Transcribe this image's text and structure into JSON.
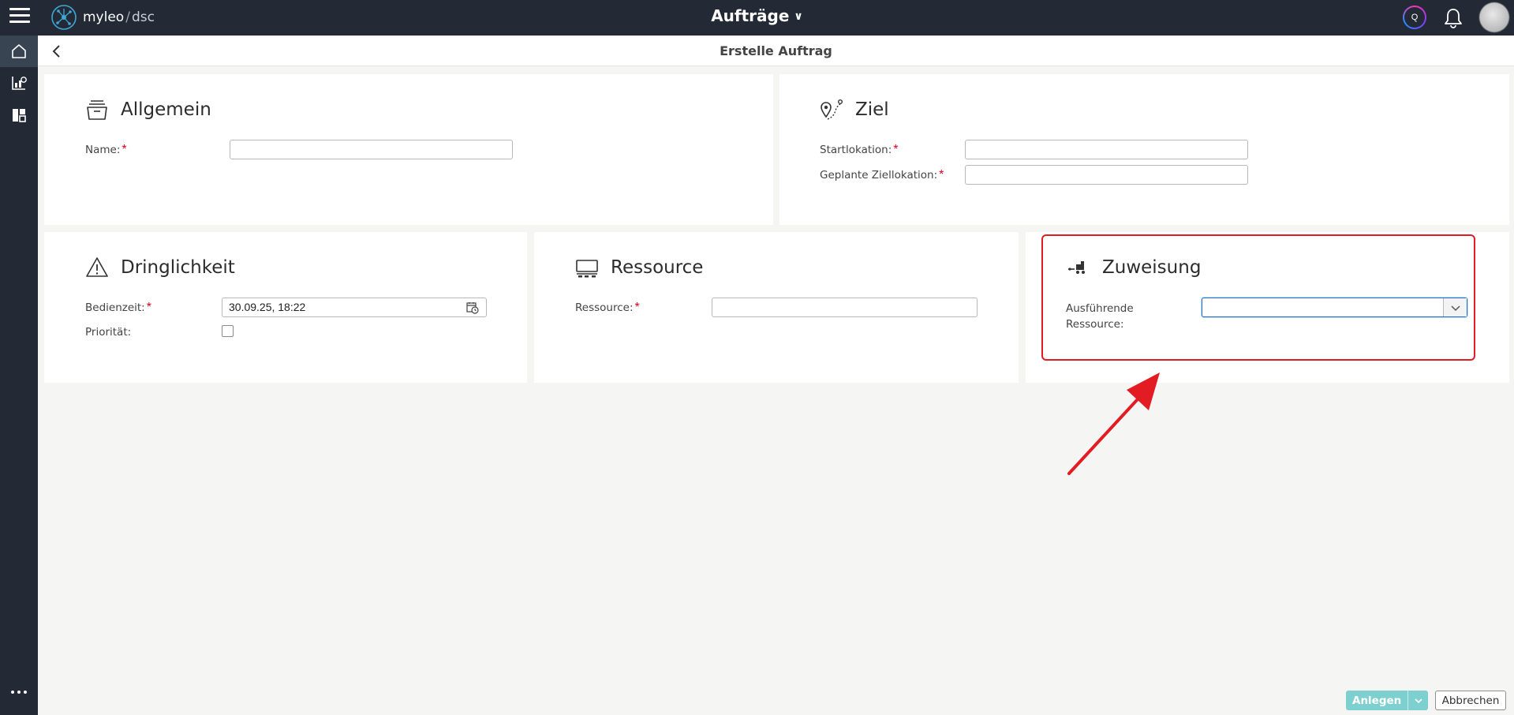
{
  "topbar": {
    "brand_name": "myleo",
    "brand_sep": "/",
    "brand_suffix": "dsc",
    "app_title": "Aufträge",
    "q_badge": "Q",
    "icons": [
      "menu-icon",
      "logo-icon",
      "chevron-down-icon",
      "q-icon",
      "bell-icon",
      "avatar"
    ]
  },
  "sidebar": {
    "items": [
      {
        "icon": "home-icon"
      },
      {
        "icon": "chart-icon"
      },
      {
        "icon": "dashboard-icon"
      }
    ],
    "more_icon": "more-icon"
  },
  "page": {
    "title": "Erstelle Auftrag",
    "back_icon": "back-arrow-icon"
  },
  "allgemein": {
    "title": "Allgemein",
    "name_label": "Name:",
    "name_value": ""
  },
  "ziel": {
    "title": "Ziel",
    "start_label": "Startlokation:",
    "start_value": "",
    "ziel_label": "Geplante Ziellokation:",
    "ziel_value": ""
  },
  "dringlichkeit": {
    "title": "Dringlichkeit",
    "bedienzeit_label": "Bedienzeit:",
    "bedienzeit_value": "30.09.25, 18:22",
    "prioritaet_label": "Priorität:",
    "prioritaet_checked": false
  },
  "ressource": {
    "title": "Ressource",
    "ressource_label": "Ressource:",
    "ressource_value": ""
  },
  "zuweisung": {
    "title": "Zuweisung",
    "label_line1": "Ausführende",
    "label_line2": "Ressource:",
    "selected_value": ""
  },
  "actions": {
    "create_label": "Anlegen",
    "cancel_label": "Abbrechen"
  },
  "required_marker": "*",
  "colors": {
    "topbar": "#232a35",
    "required": "#e0001b",
    "annotation": "#e31b23",
    "primary_button": "#7ecfcf",
    "focus": "#1c6ed3"
  }
}
